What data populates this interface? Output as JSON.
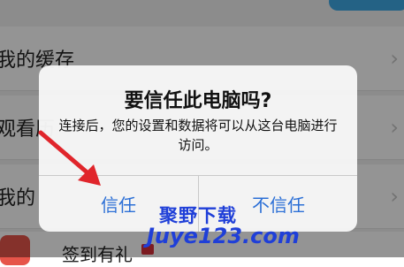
{
  "background_list": {
    "rows": [
      {
        "label": "我的缓存"
      },
      {
        "label": "观看历"
      },
      {
        "label": "我的"
      }
    ],
    "bottom_label": "签到有礼"
  },
  "dialog": {
    "title": "要信任此电脑吗?",
    "message": "连接后，您的设置和数据将可以从这台电脑进行访问。",
    "trust_label": "信任",
    "distrust_label": "不信任"
  },
  "watermark": {
    "line1": "聚野下载",
    "line2": "Juye123.com"
  },
  "colors": {
    "button_text": "#2b6fd6",
    "arrow": "#e0252b",
    "watermark": "#1f3fd8"
  }
}
